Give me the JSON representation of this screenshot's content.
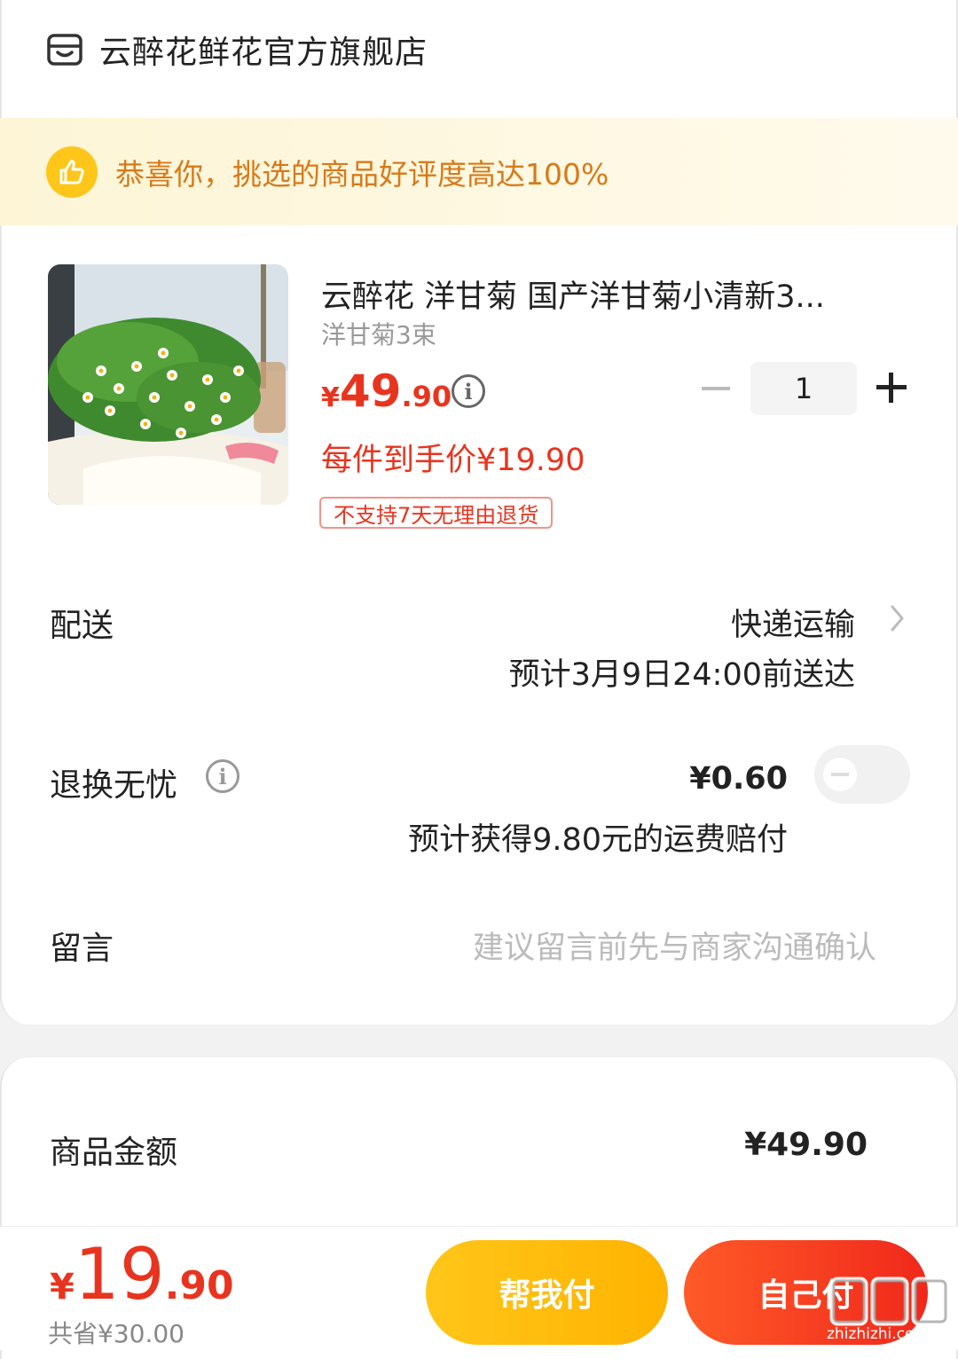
{
  "store": {
    "name": "云醉花鲜花官方旗舰店",
    "icon": "store-icon"
  },
  "banner": {
    "text": "恭喜你，挑选的商品好评度高达100%",
    "icon": "thumbs-up-icon"
  },
  "product": {
    "title": "云醉花 洋甘菊 国产洋甘菊小清新3...",
    "spec": "洋甘菊3束",
    "price_yen": "¥",
    "price_int": "49",
    "price_dec": ".90",
    "each_price": "每件到手价¥19.90",
    "tag": "不支持7天无理由退货",
    "quantity": "1"
  },
  "delivery": {
    "label": "配送",
    "method": "快递运输",
    "eta": "预计3月9日24:00前送达"
  },
  "return_service": {
    "label": "退换无忧",
    "price": "¥0.60",
    "note": "预计获得9.80元的运费赔付",
    "enabled": false
  },
  "message": {
    "label": "留言",
    "placeholder": "建议留言前先与商家沟通确认"
  },
  "summary": {
    "goods_amount_label": "商品金额",
    "goods_amount_value": "¥49.90"
  },
  "footer": {
    "total_yen": "¥",
    "total_int": "19",
    "total_dec": ".90",
    "saved": "共省¥30.00",
    "help_pay": "帮我付",
    "self_pay": "自己付"
  },
  "watermark": {
    "text": "zhizhizhi.com"
  },
  "colors": {
    "accent_red": "#e8341f",
    "accent_yellow": "#ffc61a",
    "banner_text": "#d77a1a"
  }
}
